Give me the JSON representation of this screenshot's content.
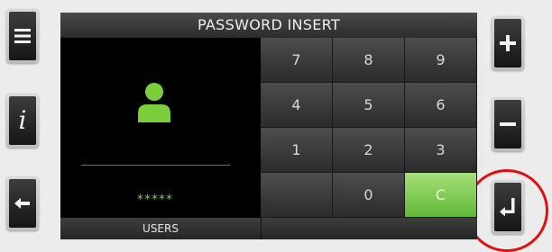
{
  "screen": {
    "title": "PASSWORD INSERT",
    "password_mask": "*****",
    "bottom_tab": "USERS"
  },
  "keypad": {
    "keys": [
      "7",
      "8",
      "9",
      "4",
      "5",
      "6",
      "1",
      "2",
      "3",
      "",
      "0",
      "C"
    ],
    "clear_key_color": "#7fcf4e"
  },
  "side_buttons": {
    "left": [
      "menu-icon",
      "info-icon",
      "back-arrow-icon"
    ],
    "right": [
      "plus-icon",
      "minus-icon",
      "enter-icon"
    ]
  },
  "colors": {
    "accent_green": "#7ccf3a",
    "highlight_ring": "#e01010"
  }
}
